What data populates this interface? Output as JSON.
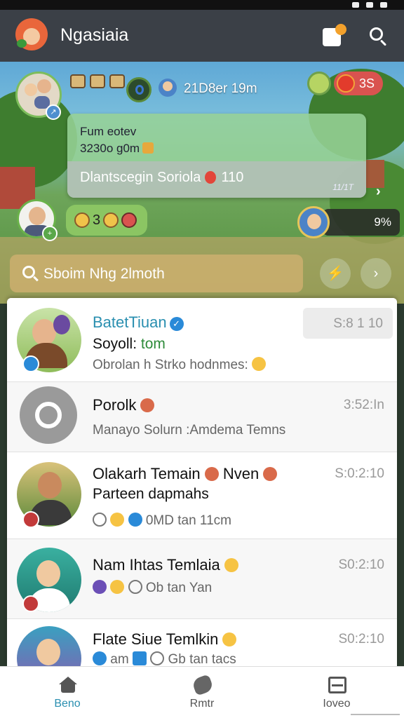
{
  "app": {
    "title": "Ngasiaia"
  },
  "scene": {
    "header_label": "21D8er 19m",
    "score": "3S",
    "card": {
      "line1": "Fum eotev",
      "line2": "3230o g0m",
      "sub_text": "Dlantscegin Soriola",
      "sub_count": "110",
      "sub_meta": "11/1T"
    },
    "emoji_pill_value": "3",
    "right_pill_value": "9%",
    "search_placeholder": "Sboim Nhg 2lmoth"
  },
  "chats": [
    {
      "name": "BatetTiuan",
      "verified": true,
      "subtitle_prefix": "Soyoll:",
      "subtitle_highlight": "tom",
      "preview": "Obrolan h Strko hodnmes:",
      "time": "S:8 1 10"
    },
    {
      "name": "Porolk",
      "preview": "Manayo Solurn :Amdema Temns",
      "time": "3:52:In"
    },
    {
      "name": "Olakarh Temain",
      "name_suffix": "Nven",
      "subtitle": "Parteen dapmahs",
      "preview": "0MD tan 11cm",
      "time": "S:0:2:10"
    },
    {
      "name": "Nam Ihtas Temlaia",
      "preview": "Ob tan Yan",
      "time": "S0:2:10"
    },
    {
      "name": "Flate Siue Temlkin",
      "preview_prefix": "am",
      "preview": "Gb tan tacs",
      "time": "S0:2:10"
    }
  ],
  "nav": {
    "items": [
      {
        "label": "Beno",
        "icon": "home-icon",
        "active": true
      },
      {
        "label": "Rmtr",
        "icon": "bird-icon",
        "active": false
      },
      {
        "label": "Ioveo",
        "icon": "inbox-icon",
        "active": false
      }
    ]
  },
  "colors": {
    "appbar": "#3b4047",
    "accent": "#2a8fb0",
    "verified": "#2a8ad8",
    "highlight_green": "#2e8b3a"
  }
}
